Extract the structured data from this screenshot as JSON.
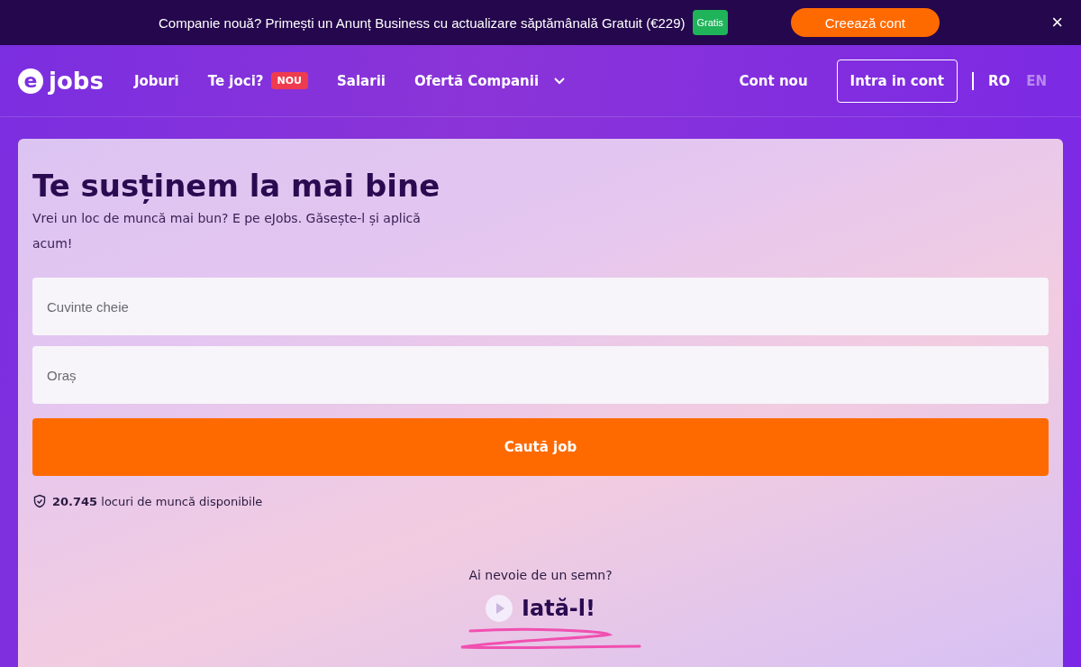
{
  "promo_bar": {
    "text": "Companie nouă? Primești un Anunț Business cu actualizare săptămânală Gratuit (€229)",
    "badge": "Gratis",
    "button": "Creează cont",
    "close": "×"
  },
  "header": {
    "logo": {
      "mark": "e",
      "text": "jobs"
    },
    "nav": [
      {
        "label": "Joburi"
      },
      {
        "label": "Te joci?",
        "badge": "NOU"
      },
      {
        "label": "Salarii"
      },
      {
        "label": "Ofertă Companii",
        "dropdown": true
      }
    ],
    "signup": "Cont nou",
    "login": "Intra in cont",
    "languages": [
      {
        "label": "RO",
        "selected": true
      },
      {
        "label": "EN",
        "selected": false
      }
    ]
  },
  "hero": {
    "title": "Te susținem la mai bine",
    "subtitle": "Vrei un loc de muncă mai bun? E pe eJobs. Găsește-l și aplică acum!",
    "fields": [
      {
        "placeholder": "Cuvinte cheie"
      },
      {
        "placeholder": "Oraș"
      }
    ],
    "search_button": "Caută job",
    "count": "**20.745** locuri de muncă disponibile",
    "video_prompt": "Ai nevoie de un semn?",
    "video_link": "Iată-l!"
  }
}
